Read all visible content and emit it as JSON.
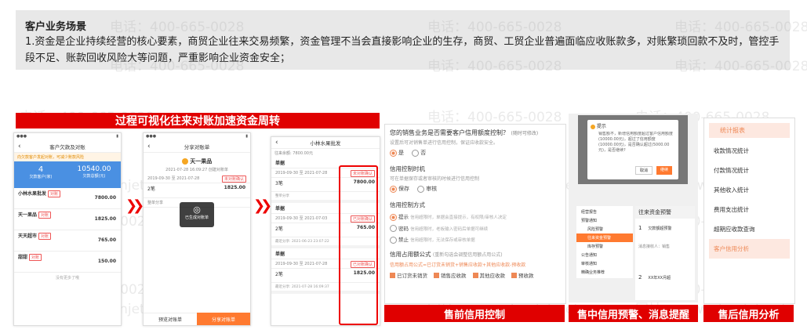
{
  "banner": {
    "title": "客户业务场景",
    "text": "1.资金是企业持续经营的核心要素，商贸企业往来交易频繁，资金管理不当会直接影响企业的生存，商贸、工贸企业普遍面临应收账款多，对账繁琐回款不及时，管控手段不足、账款回收风险大等问题，严重影响企业资金安全；"
  },
  "watermark": {
    "phone": "电话：400-665-0028",
    "site": "网址：www.chanjet.net"
  },
  "section_title": "过程可视化往来对账加速资金周转",
  "phone1": {
    "title": "客户欠款及对账",
    "hint": "向欠款客户发起对账，可减少账款风险",
    "stat_left": "4",
    "stat_left_label": "欠款客户(家)",
    "stat_right": "10540.00",
    "stat_right_label": "欠款总额(元)",
    "rows": [
      {
        "name": "小林水果批发",
        "tag": "对账",
        "amount": "7800.00"
      },
      {
        "name": "天一果品",
        "tag": "对账",
        "amount": "1825.00"
      },
      {
        "name": "天天超市",
        "tag": "对账",
        "amount": "765.00"
      },
      {
        "name": "甜甜",
        "tag": "对账",
        "amount": "150.00"
      }
    ],
    "footer": "没有更多了哦"
  },
  "phone2": {
    "title": "分享对账单",
    "shop": "天一果品",
    "date_line": "2021-07-28 16:09:27 创建对账单",
    "period": "2019-09-30 至 2021-07-28",
    "status": "未对账确认",
    "count": "2笔",
    "amount": "1825.00",
    "detail": "整单分享",
    "toast": "已生成对账单",
    "btn_left": "预览对账单",
    "btn_right": "分享对账单"
  },
  "phone3": {
    "title": "小林水果批发",
    "summary": "往来余额: 7800.00元",
    "tab": "单据",
    "rows": [
      {
        "period": "2019-09-30 至 2021-07-28",
        "status": "未对账确认",
        "count": "3笔",
        "amount": "7800.00",
        "note": "整单分享"
      },
      {
        "period": "2019-09-30 至 2021-07-03",
        "status": "已对账确认",
        "count": "2笔",
        "amount": "765.00",
        "note": "最近分享: 2021-06-23 23:07:22"
      },
      {
        "period": "2019-09-30 至 2021-07-28",
        "status": "已对账确认",
        "count": "2笔",
        "amount": "1825.00",
        "note": "最近分享: 2021-07-28 16:09:37"
      }
    ]
  },
  "credit": {
    "question": "您的销售业务是否需要客户信用额度控制？",
    "question_sub": "(随时可修改)",
    "note": "设置后可对销售单进行信用控制，保证应收款安全。",
    "yes": "是",
    "no": "否",
    "timing_title": "信用控制时机",
    "timing_note": "可在单据保存或者审核的时候进行信用控制",
    "save": "保存",
    "audit": "审核",
    "method_title": "信用控制方式",
    "methods": [
      {
        "label": "提示",
        "desc": "信用超限时，单据会直接提示，有权限/审核人决定"
      },
      {
        "label": "密码",
        "desc": "信用超限时，老板输入密码后单据可继续"
      },
      {
        "label": "禁止",
        "desc": "信用超限时，无法保存或审核单据"
      }
    ],
    "formula_title": "信用占用额公式",
    "formula_sub": "(重新勾选会调整信用额占用公式)",
    "formula": "信用额占用公式=已订货未销货+销售应收款+其他应收款-预收款",
    "checks": [
      "已订货未销货",
      "销售应收款",
      "其他应收款",
      "预收款"
    ],
    "label": "售前信用控制"
  },
  "alert": {
    "dialog_title": "提示",
    "dialog_text": "销售额不，新增信用额度超过客户信用额度(10000.00元)，超过了信用额度(10000.00元)，是否确认超过(5000.00元)，是否继续?",
    "cancel": "取消",
    "ok": "继续",
    "menu": [
      "经营报告",
      "预警通知",
      "风险预警",
      "往来资金预警",
      "库存预警",
      "公告通知",
      "审核通知",
      "精确业务推荐"
    ],
    "panel_title": "往来资金预警",
    "item_num": "1",
    "item_text": "欠款额超预警",
    "recipient": "消息接收人：销售",
    "bottom_num": "2",
    "bottom_text": "XX年XX月超",
    "label": "售中信用预警、消息提醒"
  },
  "report": {
    "title": "统计报表",
    "items": [
      "收款情况统计",
      "付款情况统计",
      "其他收入统计",
      "费用支出统计",
      "超期应收款查询",
      "客户信用分析"
    ],
    "label": "售后信用分析"
  }
}
